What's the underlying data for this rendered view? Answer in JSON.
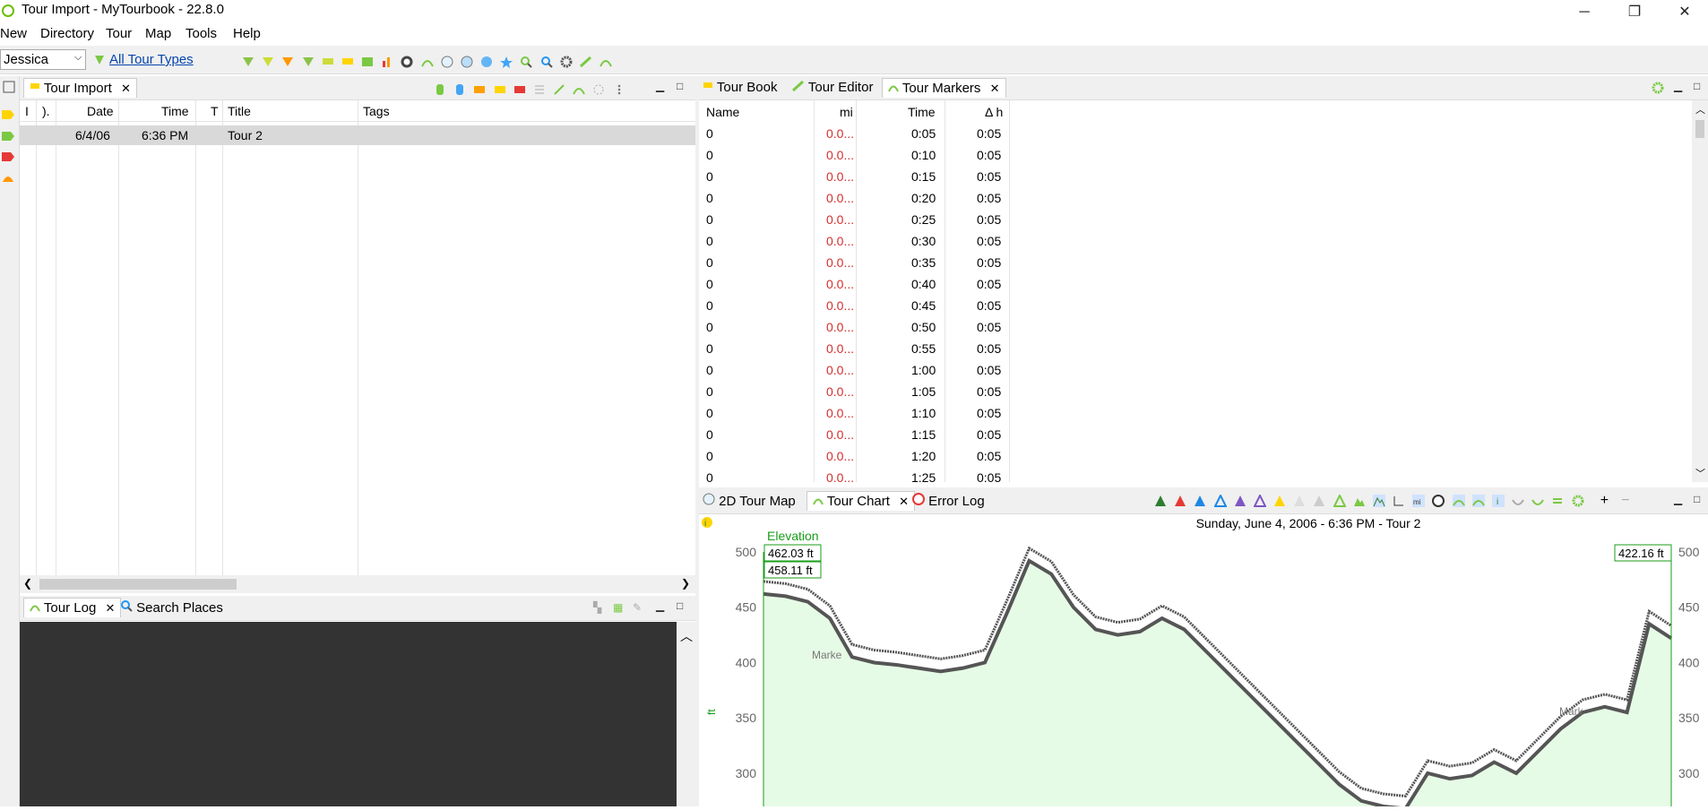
{
  "window": {
    "title": "Tour Import - MyTourbook - 22.8.0",
    "min_label": "─",
    "max_label": "❐",
    "close_label": "✕"
  },
  "menu": [
    "New",
    "Directory",
    "Tour",
    "Map",
    "Tools",
    "Help"
  ],
  "toolbar": {
    "person": "Jessica",
    "tour_types_link": "All Tour Types"
  },
  "tour_import": {
    "tab_label": "Tour Import",
    "columns": [
      "I",
      ").",
      "Date",
      "Time",
      "T",
      "Title",
      "Tags"
    ],
    "rows": [
      {
        "date": "6/4/06",
        "time": "6:36 PM",
        "title": "Tour 2"
      }
    ]
  },
  "tour_log": {
    "tab_label": "Tour Log",
    "search_tab_label": "Search Places"
  },
  "right_tabs": {
    "tour_book": "Tour Book",
    "tour_editor": "Tour Editor",
    "tour_markers": "Tour Markers"
  },
  "markers": {
    "columns": [
      "Name",
      "mi",
      "Time",
      "Δ h"
    ],
    "rows": [
      {
        "name": "0",
        "mi": "0.0...",
        "time": "0:05",
        "dh": "0:05"
      },
      {
        "name": "0",
        "mi": "0.0...",
        "time": "0:10",
        "dh": "0:05"
      },
      {
        "name": "0",
        "mi": "0.0...",
        "time": "0:15",
        "dh": "0:05"
      },
      {
        "name": "0",
        "mi": "0.0...",
        "time": "0:20",
        "dh": "0:05"
      },
      {
        "name": "0",
        "mi": "0.0...",
        "time": "0:25",
        "dh": "0:05"
      },
      {
        "name": "0",
        "mi": "0.0...",
        "time": "0:30",
        "dh": "0:05"
      },
      {
        "name": "0",
        "mi": "0.0...",
        "time": "0:35",
        "dh": "0:05"
      },
      {
        "name": "0",
        "mi": "0.0...",
        "time": "0:40",
        "dh": "0:05"
      },
      {
        "name": "0",
        "mi": "0.0...",
        "time": "0:45",
        "dh": "0:05"
      },
      {
        "name": "0",
        "mi": "0.0...",
        "time": "0:50",
        "dh": "0:05"
      },
      {
        "name": "0",
        "mi": "0.0...",
        "time": "0:55",
        "dh": "0:05"
      },
      {
        "name": "0",
        "mi": "0.0...",
        "time": "1:00",
        "dh": "0:05"
      },
      {
        "name": "0",
        "mi": "0.0...",
        "time": "1:05",
        "dh": "0:05"
      },
      {
        "name": "0",
        "mi": "0.0...",
        "time": "1:10",
        "dh": "0:05"
      },
      {
        "name": "0",
        "mi": "0.0...",
        "time": "1:15",
        "dh": "0:05"
      },
      {
        "name": "0",
        "mi": "0.0...",
        "time": "1:20",
        "dh": "0:05"
      },
      {
        "name": "0",
        "mi": "0.0...",
        "time": "1:25",
        "dh": "0:05"
      }
    ]
  },
  "bottom_tabs": {
    "map": "2D Tour Map",
    "chart": "Tour Chart",
    "error": "Error Log"
  },
  "chart": {
    "title": "Sunday, June 4, 2006 - 6:36 PM - Tour 2",
    "series_label": "Elevation",
    "unit": "ft",
    "val_left_1": "462.03 ft",
    "val_left_2": "458.11 ft",
    "val_right": "422.16 ft",
    "marker_label_1": "Marke",
    "marker_label_2": "Mark",
    "colors": {
      "fill": "#e6fbe6",
      "line": "#555555",
      "accent": "#1a9c1a"
    }
  },
  "chart_data": {
    "type": "area",
    "ylabel": "ft",
    "ylim": [
      270,
      500
    ],
    "yticks": [
      300,
      350,
      400,
      450,
      500
    ],
    "series": [
      {
        "values": [
          462,
          460,
          455,
          440,
          405,
          400,
          398,
          395,
          392,
          395,
          400,
          445,
          492,
          480,
          450,
          430,
          425,
          428,
          440,
          430,
          410,
          390,
          370,
          350,
          330,
          310,
          290,
          275,
          270,
          268,
          300,
          295,
          298,
          310,
          300,
          320,
          340,
          355,
          360,
          355,
          435,
          422
        ]
      }
    ]
  }
}
